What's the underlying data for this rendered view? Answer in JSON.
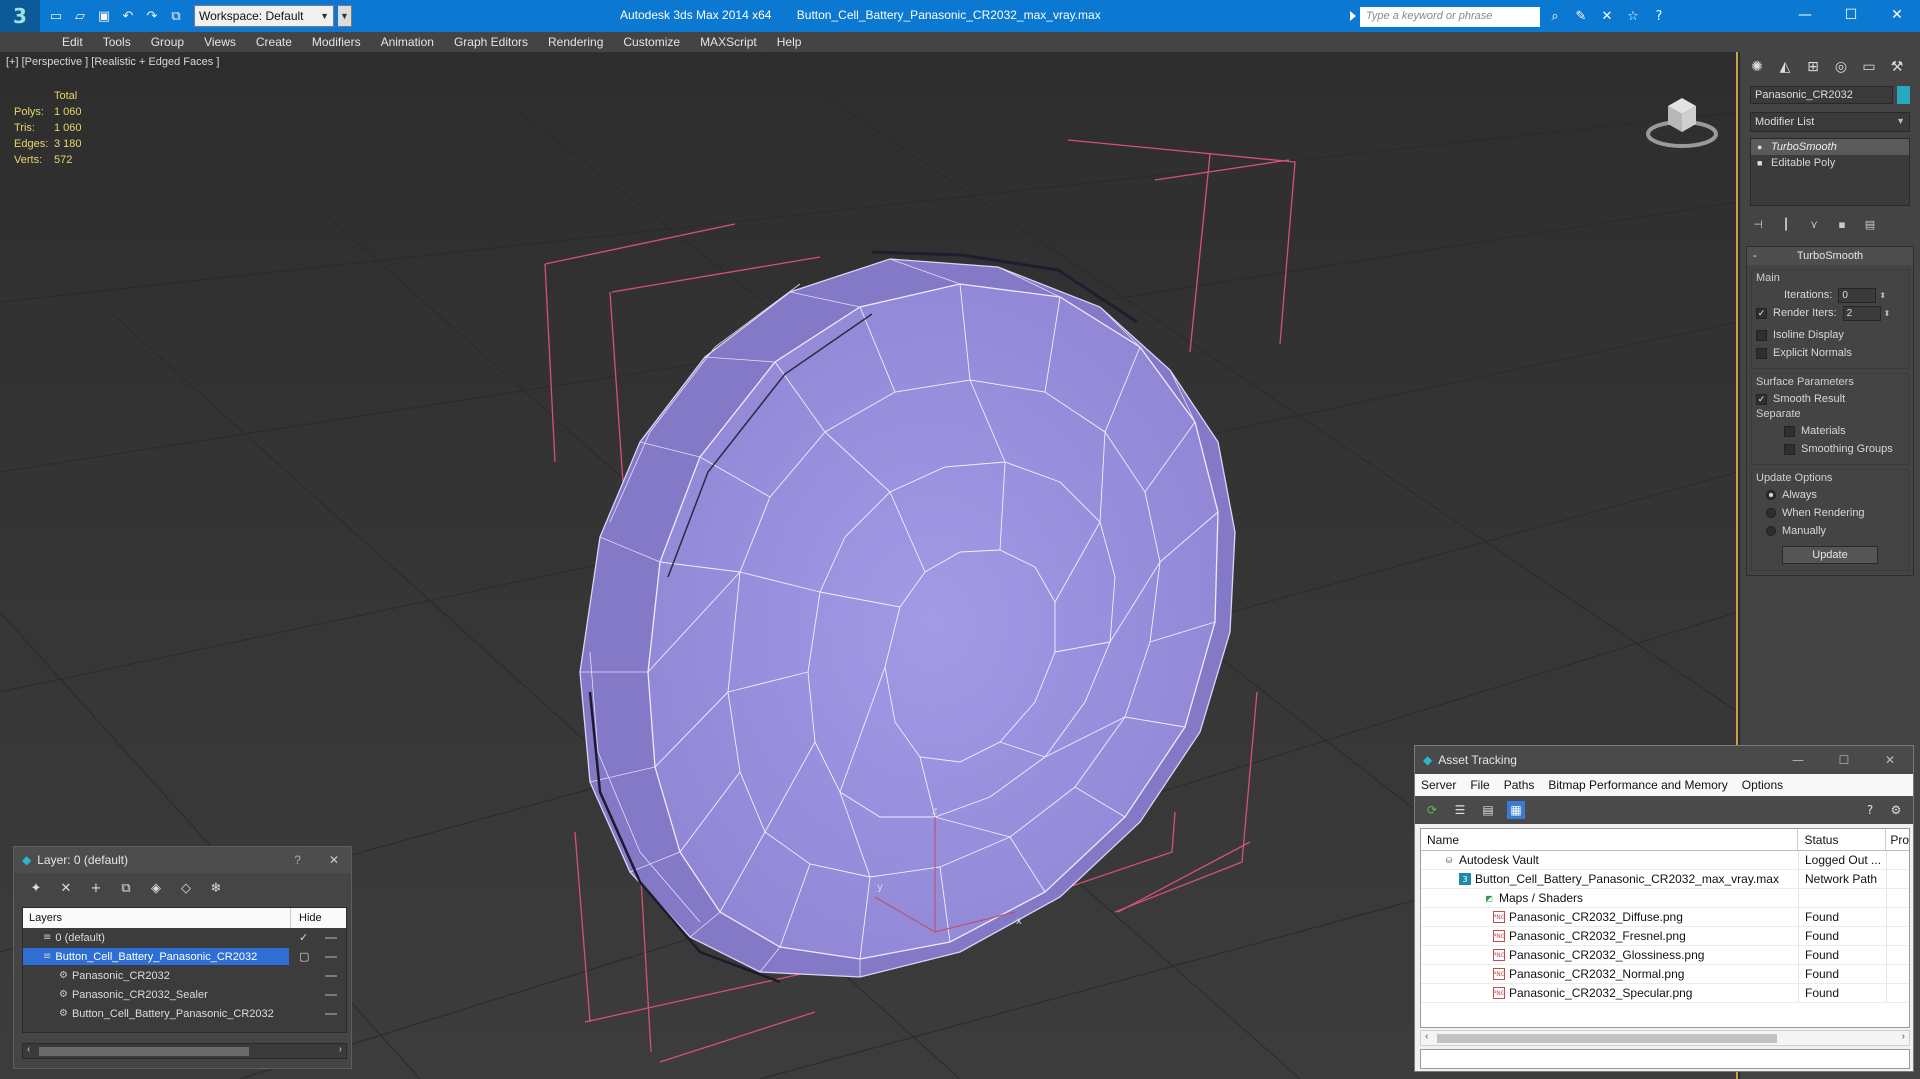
{
  "titlebar": {
    "workspace_label": "Workspace: Default",
    "app_title": "Autodesk 3ds Max  2014 x64",
    "file_title": "Button_Cell_Battery_Panasonic_CR2032_max_vray.max",
    "search_placeholder": "Type a keyword or phrase"
  },
  "menu": [
    "Edit",
    "Tools",
    "Group",
    "Views",
    "Create",
    "Modifiers",
    "Animation",
    "Graph Editors",
    "Rendering",
    "Customize",
    "MAXScript",
    "Help"
  ],
  "viewport": {
    "label": "[+] [Perspective ] [Realistic + Edged Faces ]",
    "stats": {
      "header": "Total",
      "rows": [
        {
          "k": "Polys:",
          "v": "1 060"
        },
        {
          "k": "Tris:",
          "v": "1 060"
        },
        {
          "k": "Edges:",
          "v": "3 180"
        },
        {
          "k": "Verts:",
          "v": "572"
        }
      ]
    },
    "axis_labels": {
      "x": "x",
      "y": "y",
      "z": "z"
    }
  },
  "command_panel": {
    "object_name": "Panasonic_CR2032",
    "object_color": "#27a9c2",
    "modifier_list_label": "Modifier List",
    "stack": [
      {
        "label": "TurboSmooth",
        "selected": true
      },
      {
        "label": "Editable Poly",
        "selected": false
      }
    ],
    "rollout": {
      "title": "TurboSmooth",
      "main_label": "Main",
      "iterations_label": "Iterations:",
      "iterations_value": "0",
      "render_iters_label": "Render Iters:",
      "render_iters_value": "2",
      "isoline_label": "Isoline Display",
      "explicit_normals_label": "Explicit Normals",
      "surface_params_label": "Surface Parameters",
      "smooth_result_label": "Smooth Result",
      "separate_label": "Separate",
      "materials_label": "Materials",
      "smoothing_groups_label": "Smoothing Groups",
      "update_options_label": "Update Options",
      "always_label": "Always",
      "when_rendering_label": "When Rendering",
      "manually_label": "Manually",
      "update_button": "Update"
    }
  },
  "layer_window": {
    "title": "Layer: 0 (default)",
    "help": "?",
    "col_layers": "Layers",
    "col_hide": "Hide",
    "rows": [
      {
        "label": "0 (default)",
        "indent": 1,
        "selected": false,
        "mark": "✓"
      },
      {
        "label": "Button_Cell_Battery_Panasonic_CR2032",
        "indent": 1,
        "selected": true,
        "mark": "▢"
      },
      {
        "label": "Panasonic_CR2032",
        "indent": 2,
        "selected": false,
        "mark": ""
      },
      {
        "label": "Panasonic_CR2032_Sealer",
        "indent": 2,
        "selected": false,
        "mark": ""
      },
      {
        "label": "Button_Cell_Battery_Panasonic_CR2032",
        "indent": 2,
        "selected": false,
        "mark": ""
      }
    ]
  },
  "asset_window": {
    "title": "Asset Tracking",
    "menu": [
      "Server",
      "File",
      "Paths",
      "Bitmap Performance and Memory",
      "Options"
    ],
    "col_name": "Name",
    "col_status": "Status",
    "col_extra": "Pro",
    "rows": [
      {
        "name": "Autodesk Vault",
        "status": "Logged Out ...",
        "indent": 1,
        "icon": "vault"
      },
      {
        "name": "Button_Cell_Battery_Panasonic_CR2032_max_vray.max",
        "status": "Network Path",
        "indent": 2,
        "icon": "max"
      },
      {
        "name": "Maps / Shaders",
        "status": "",
        "indent": 3,
        "icon": "map"
      },
      {
        "name": "Panasonic_CR2032_Diffuse.png",
        "status": "Found",
        "indent": 4,
        "icon": "png"
      },
      {
        "name": "Panasonic_CR2032_Fresnel.png",
        "status": "Found",
        "indent": 4,
        "icon": "png"
      },
      {
        "name": "Panasonic_CR2032_Glossiness.png",
        "status": "Found",
        "indent": 4,
        "icon": "png"
      },
      {
        "name": "Panasonic_CR2032_Normal.png",
        "status": "Found",
        "indent": 4,
        "icon": "png"
      },
      {
        "name": "Panasonic_CR2032_Specular.png",
        "status": "Found",
        "indent": 4,
        "icon": "png"
      }
    ]
  }
}
